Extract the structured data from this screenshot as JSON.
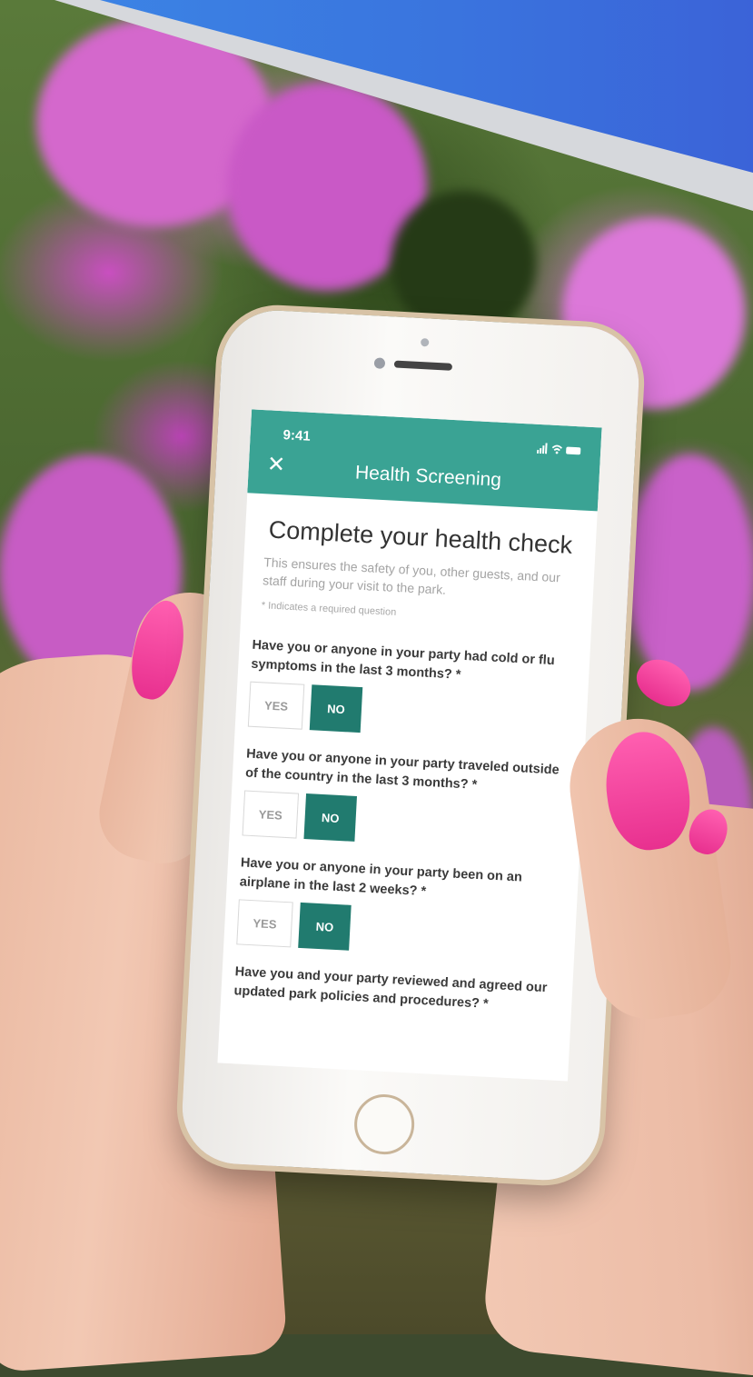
{
  "status_bar": {
    "time": "9:41",
    "icons": "signal-wifi-battery"
  },
  "header": {
    "title": "Health Screening",
    "close_icon": "close-icon"
  },
  "form": {
    "title": "Complete your health check",
    "intro": "This ensures the safety of you, other guests, and our staff during your visit to the park.",
    "required_note": "* Indicates a required question",
    "questions": [
      {
        "text": "Have you or anyone in your party had cold or flu symptoms in the last 3 months? *",
        "yes_label": "YES",
        "no_label": "NO",
        "selected": "NO"
      },
      {
        "text": "Have you or anyone in your party traveled outside of the country in the last 3 months? *",
        "yes_label": "YES",
        "no_label": "NO",
        "selected": "NO"
      },
      {
        "text": "Have you or anyone in your party been on an airplane in the last 2 weeks? *",
        "yes_label": "YES",
        "no_label": "NO",
        "selected": "NO"
      },
      {
        "text": "Have you and your party reviewed and agreed our updated park policies and procedures? *"
      }
    ]
  },
  "colors": {
    "header": "#3aa394",
    "selected_button": "#217b6f",
    "banner": "#3a74de"
  }
}
